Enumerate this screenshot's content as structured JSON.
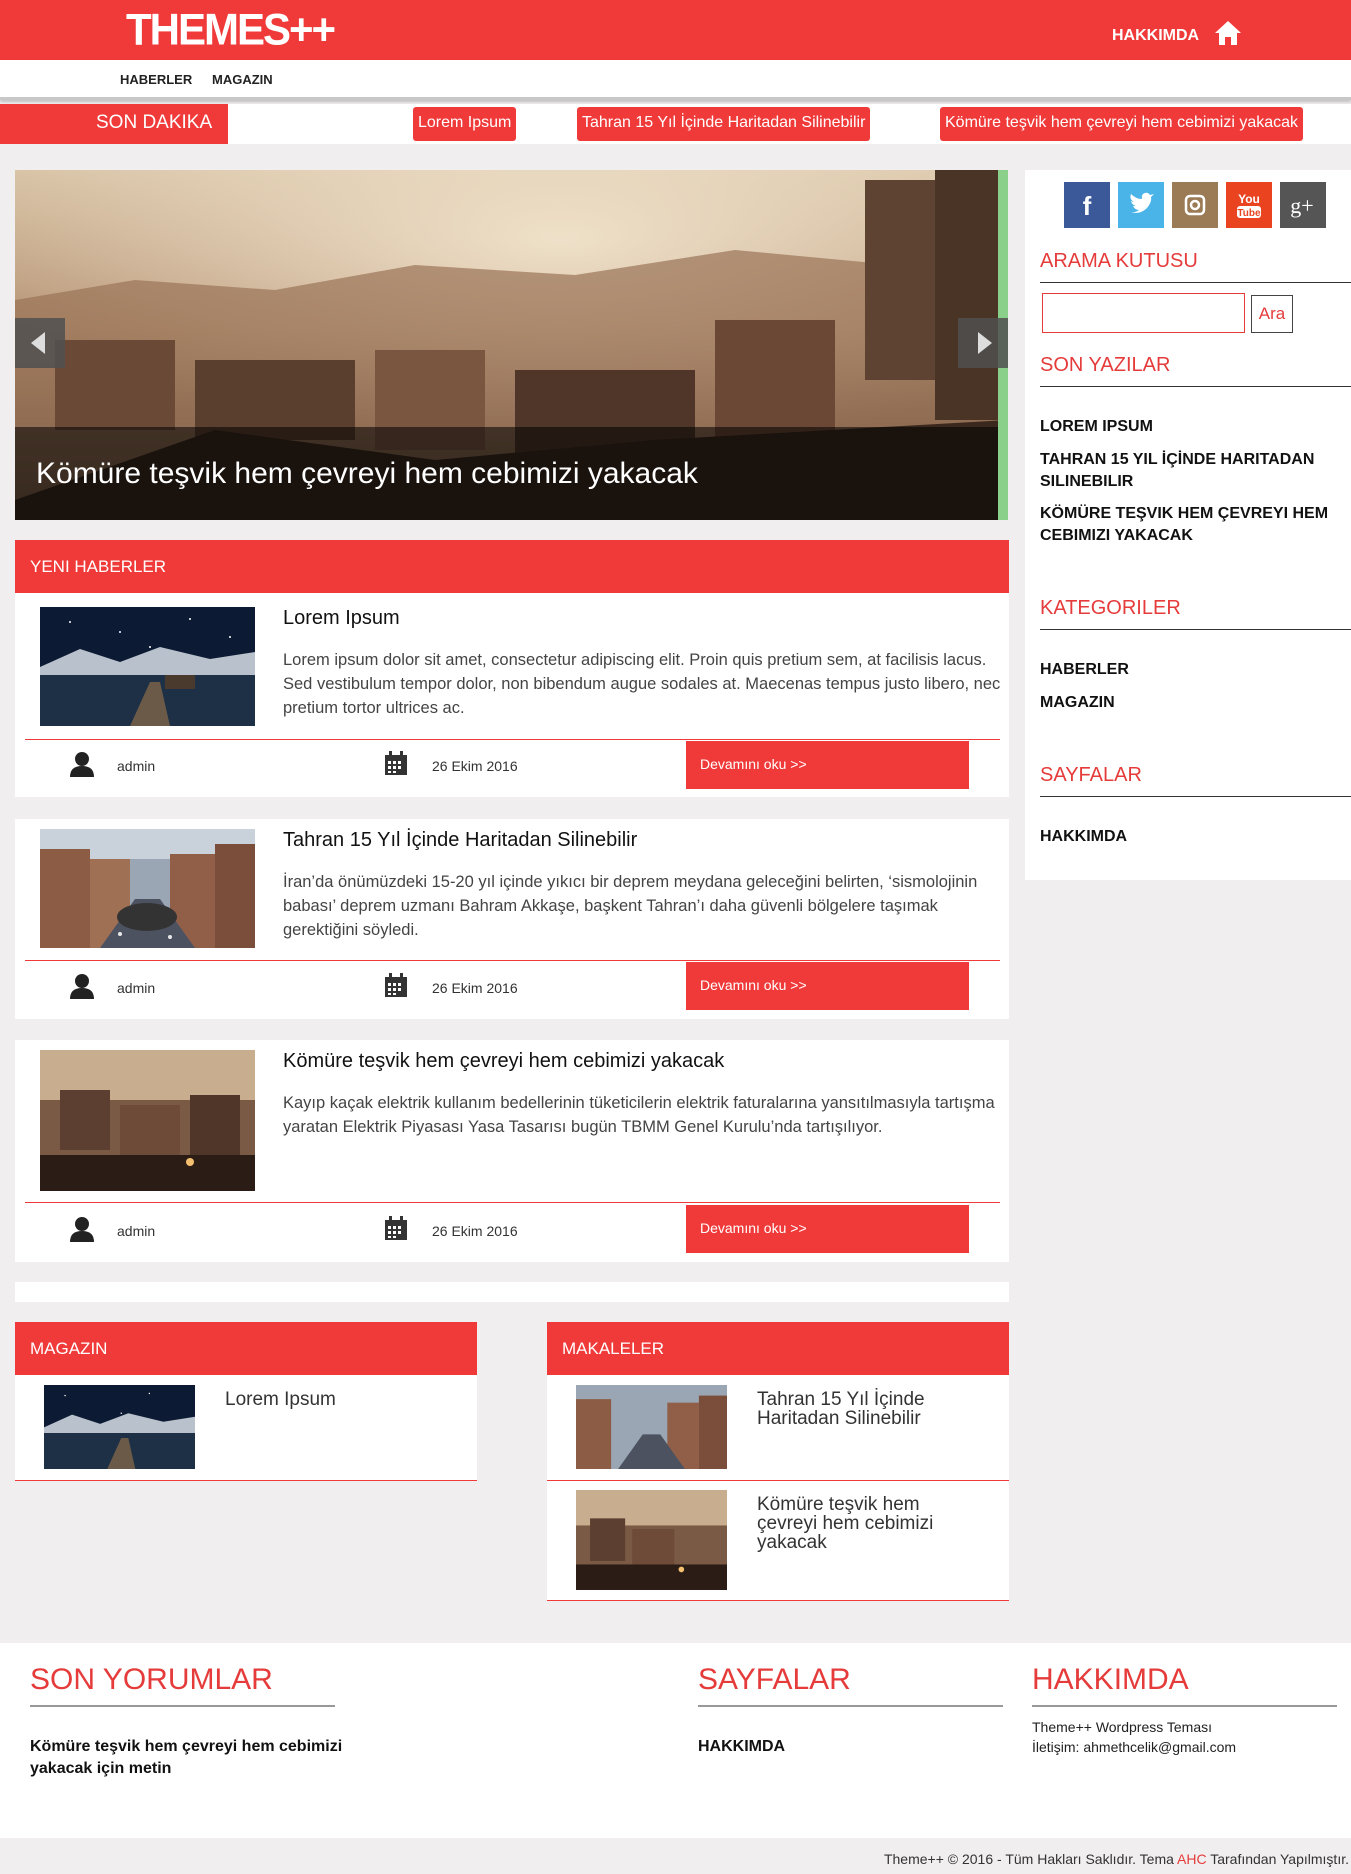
{
  "header": {
    "logo": "THEMES++",
    "about_link": "HAKKIMDA",
    "nav": [
      "HABERLER",
      "MAGAZIN"
    ]
  },
  "breaking": {
    "label": "SON DAKIKA",
    "items": [
      "Lorem Ipsum",
      "Tahran 15 Yıl İçinde Haritadan Silinebilir",
      "Kömüre teşvik hem çevreyi hem cebimizi yakacak"
    ]
  },
  "slider": {
    "caption": "Kömüre teşvik hem çevreyi hem cebimizi yakacak"
  },
  "news": {
    "heading": "YENI HABERLER",
    "posts": [
      {
        "title": "Lorem Ipsum",
        "excerpt": "Lorem ipsum dolor sit amet, consectetur adipiscing elit. Proin quis pretium sem, at facilisis lacus. Sed vestibulum tempor dolor, non bibendum augue sodales at. Maecenas tempus justo libero, nec pretium tortor ultrices ac.",
        "author": "admin",
        "date": "26 Ekim 2016",
        "read_more": "Devamını oku >>"
      },
      {
        "title": "Tahran 15 Yıl İçinde Haritadan Silinebilir",
        "excerpt": "İran’da önümüzdeki 15-20 yıl içinde yıkıcı bir deprem meydana geleceğini belirten, ‘sismolojinin babası’ deprem uzmanı Bahram Akkaşe, başkent Tahran’ı daha güvenli bölgelere taşımak gerektiğini söyledi.",
        "author": "admin",
        "date": "26 Ekim 2016",
        "read_more": "Devamını oku >>"
      },
      {
        "title": "Kömüre teşvik hem çevreyi hem cebimizi yakacak",
        "excerpt": "Kayıp kaçak elektrik kullanım bedellerinin tüketicilerin elektrik faturalarına yansıtılmasıyla tartışma yaratan Elektrik Piyasası Yasa Tasarısı bugün TBMM Genel Kurulu’nda tartışılıyor.",
        "author": "admin",
        "date": "26 Ekim 2016",
        "read_more": "Devamını oku >>"
      }
    ]
  },
  "magazin": {
    "heading": "MAGAZIN",
    "items": [
      {
        "title": "Lorem Ipsum"
      }
    ]
  },
  "makaleler": {
    "heading": "MAKALELER",
    "items": [
      {
        "title": "Tahran 15 Yıl İçinde Haritadan Silinebilir"
      },
      {
        "title": "Kömüre teşvik hem çevreyi hem cebimizi yakacak"
      }
    ]
  },
  "sidebar": {
    "social": [
      "facebook-icon",
      "twitter-icon",
      "instagram-icon",
      "youtube-icon",
      "google-plus-icon"
    ],
    "search_heading": "ARAMA KUTUSU",
    "search_button": "Ara",
    "recent_heading": "SON YAZILAR",
    "recent": [
      "LOREM IPSUM",
      "TAHRAN 15 YIL İÇİNDE HARITADAN SILINEBILIR",
      "KÖMÜRE TEŞVIK HEM ÇEVREYI HEM CEBIMIZI YAKACAK"
    ],
    "categories_heading": "KATEGORILER",
    "categories": [
      "HABERLER",
      "MAGAZIN"
    ],
    "pages_heading": "SAYFALAR",
    "pages": [
      "HAKKIMDA"
    ]
  },
  "footer": {
    "comments_heading": "SON YORUMLAR",
    "comment": "Kömüre teşvik hem çevreyi hem cebimizi yakacak için metin",
    "pages_heading": "SAYFALAR",
    "pages_item": "HAKKIMDA",
    "about_heading": "HAKKIMDA",
    "about_text": "Theme++ Wordpress Teması İletişim: ahmethcelik@gmail.com",
    "copyright_pre": "Theme++ © 2016 - Tüm Hakları Saklıdır. Tema ",
    "copyright_accent": "AHC",
    "copyright_post": " Tarafından Yapılmıştır."
  },
  "colors": {
    "accent": "#f03a3a"
  }
}
